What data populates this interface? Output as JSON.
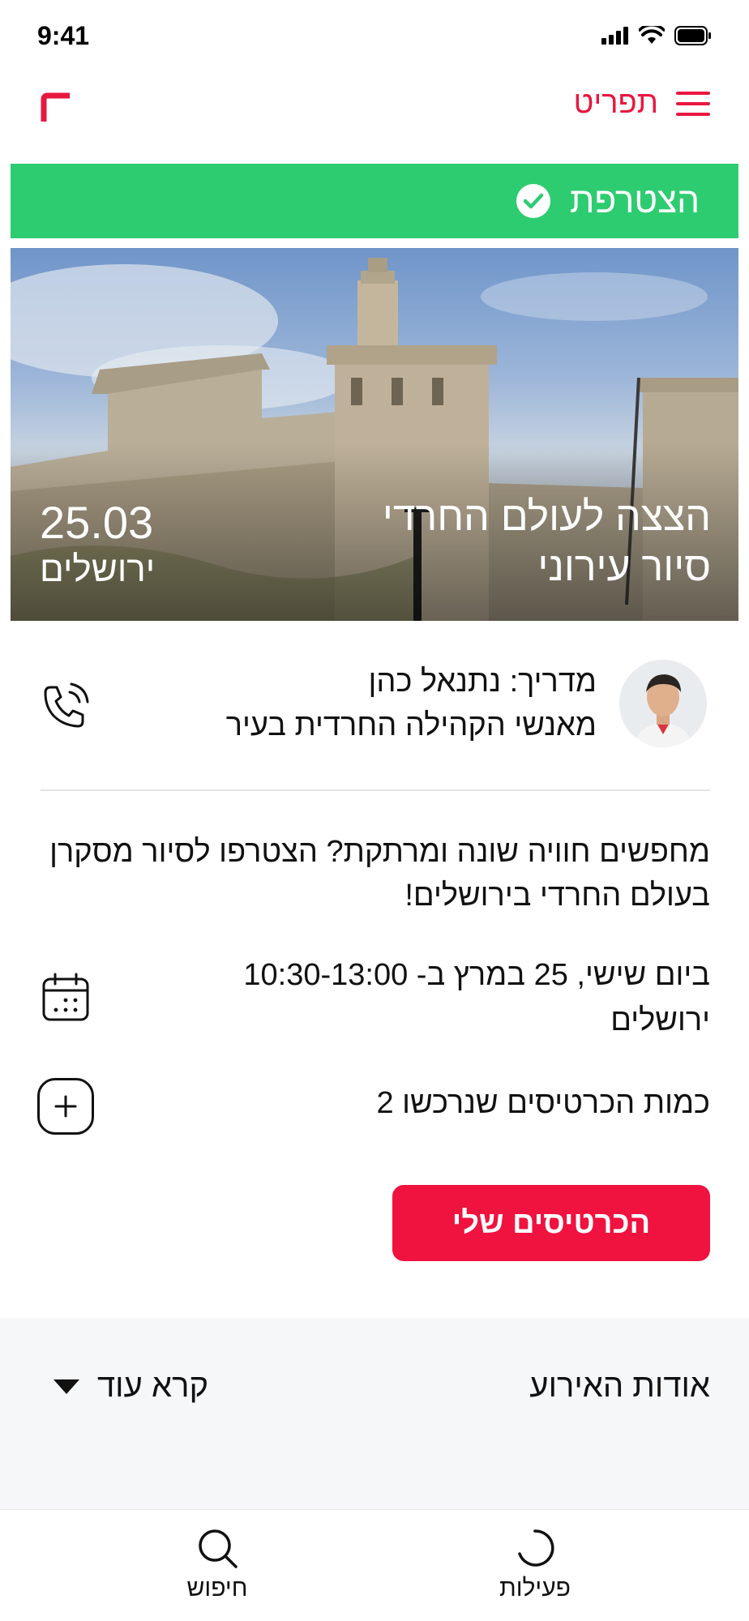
{
  "status_bar": {
    "time": "9:41"
  },
  "header": {
    "menu_label": "תפריט"
  },
  "banner": {
    "status": "הצטרפת"
  },
  "event": {
    "title": "הצצה לעולם החרדי",
    "subtitle": "סיור עירוני",
    "date": "25.03",
    "city": "ירושלים"
  },
  "guide": {
    "name": "מדריך: נתנאל כהן",
    "role": "מאנשי הקהילה החרדית בעיר"
  },
  "description": "מחפשים חוויה שונה ומרתקת? הצטרפו לסיור מסקרן בעולם החרדי בירושלים!",
  "schedule": {
    "when": "ביום שישי, 25 במרץ ב- 10:30-13:00",
    "where": "ירושלים"
  },
  "tickets": {
    "count_text": "כמות הכרטיסים שנרכשו 2",
    "button_label": "הכרטיסים שלי"
  },
  "about": {
    "title": "אודות האירוע",
    "read_more": "קרא עוד"
  },
  "bottom_nav": {
    "activities": "פעילות",
    "search": "חיפוש"
  },
  "colors": {
    "accent": "#e8173f",
    "success": "#2ecc71",
    "button": "#f0123f"
  }
}
